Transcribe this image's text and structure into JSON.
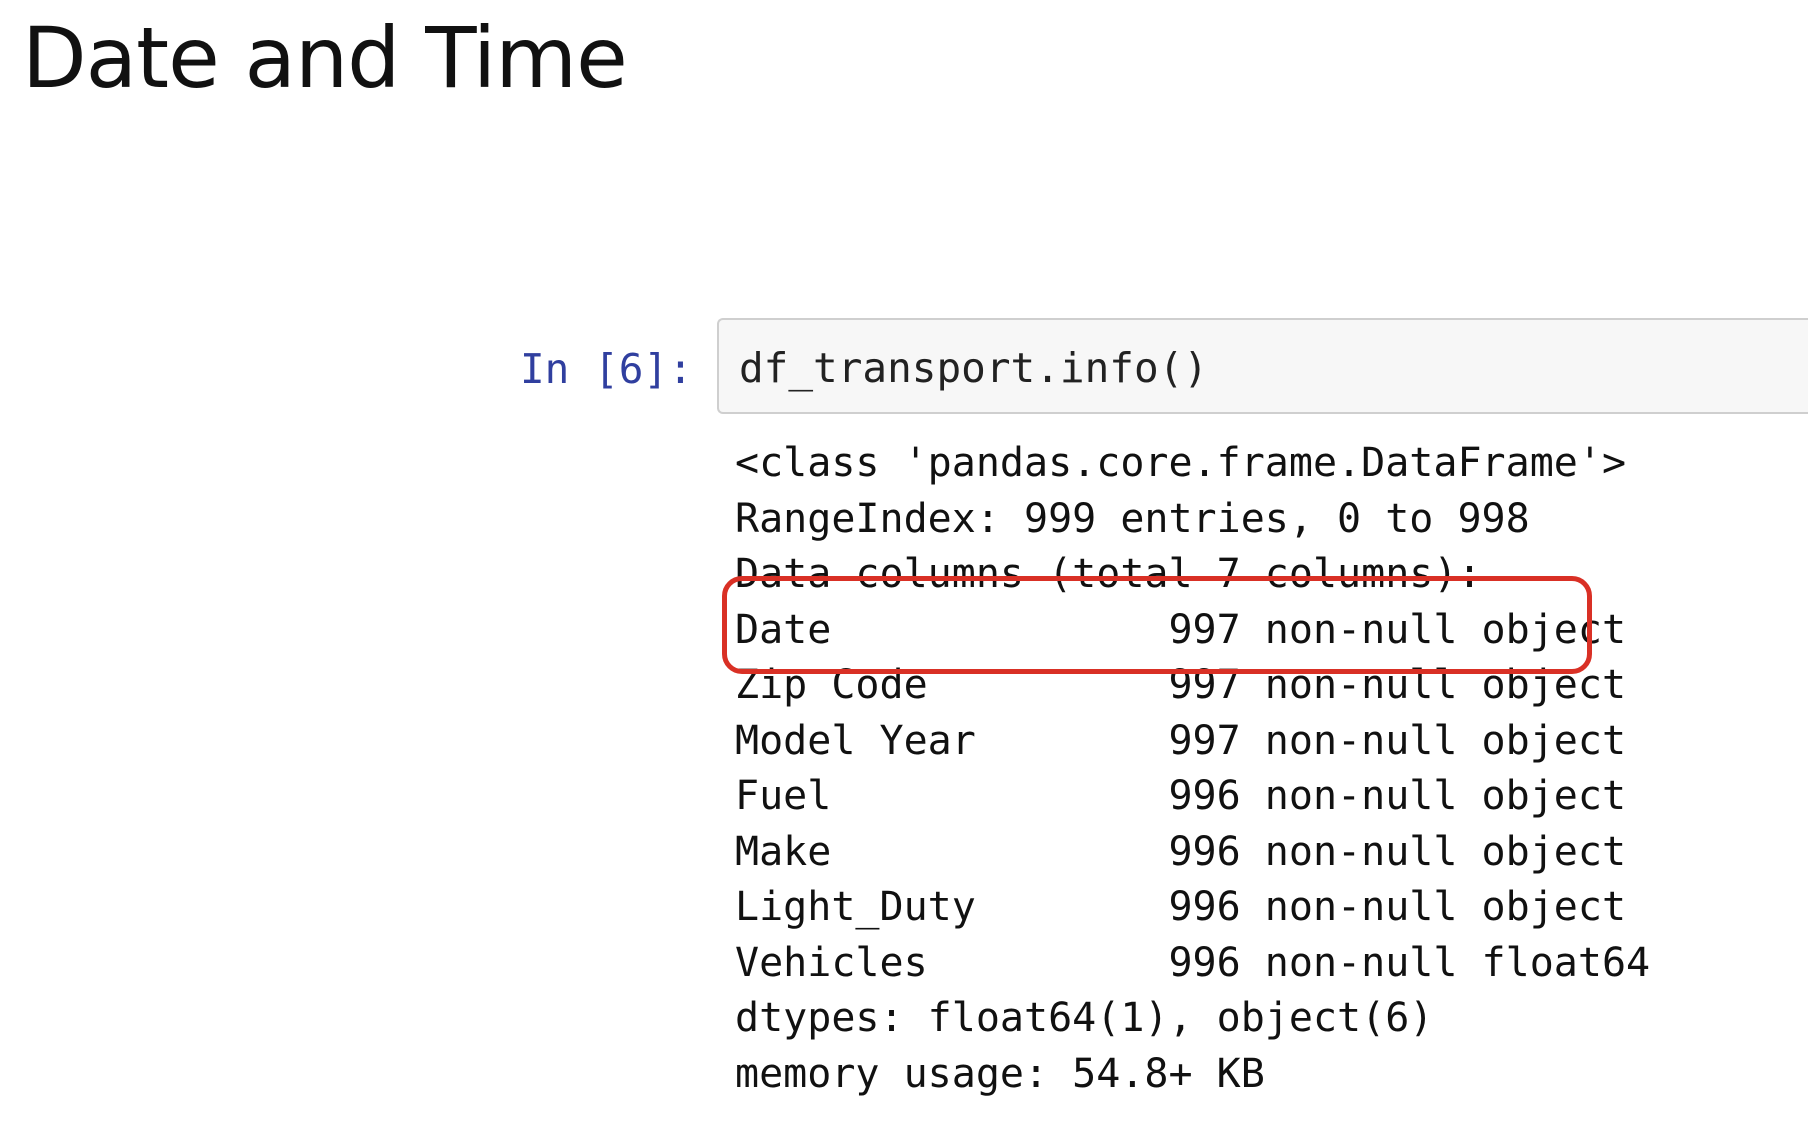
{
  "slide": {
    "title": "Date and Time"
  },
  "cell": {
    "prompt": "In [6]:",
    "code": "df_transport.info()"
  },
  "output": {
    "lines": [
      "<class 'pandas.core.frame.DataFrame'>",
      "RangeIndex: 999 entries, 0 to 998",
      "Data columns (total 7 columns):",
      "Date              997 non-null object",
      "Zip Code          997 non-null object",
      "Model Year        997 non-null object",
      "Fuel              996 non-null object",
      "Make              996 non-null object",
      "Light_Duty        996 non-null object",
      "Vehicles          996 non-null float64",
      "dtypes: float64(1), object(6)",
      "memory usage: 54.8+ KB"
    ]
  },
  "highlight": {
    "color": "#d93025"
  },
  "colors": {
    "prompt": "#303f9f",
    "input_background": "#f7f7f7",
    "input_border": "#cfcfcf"
  }
}
